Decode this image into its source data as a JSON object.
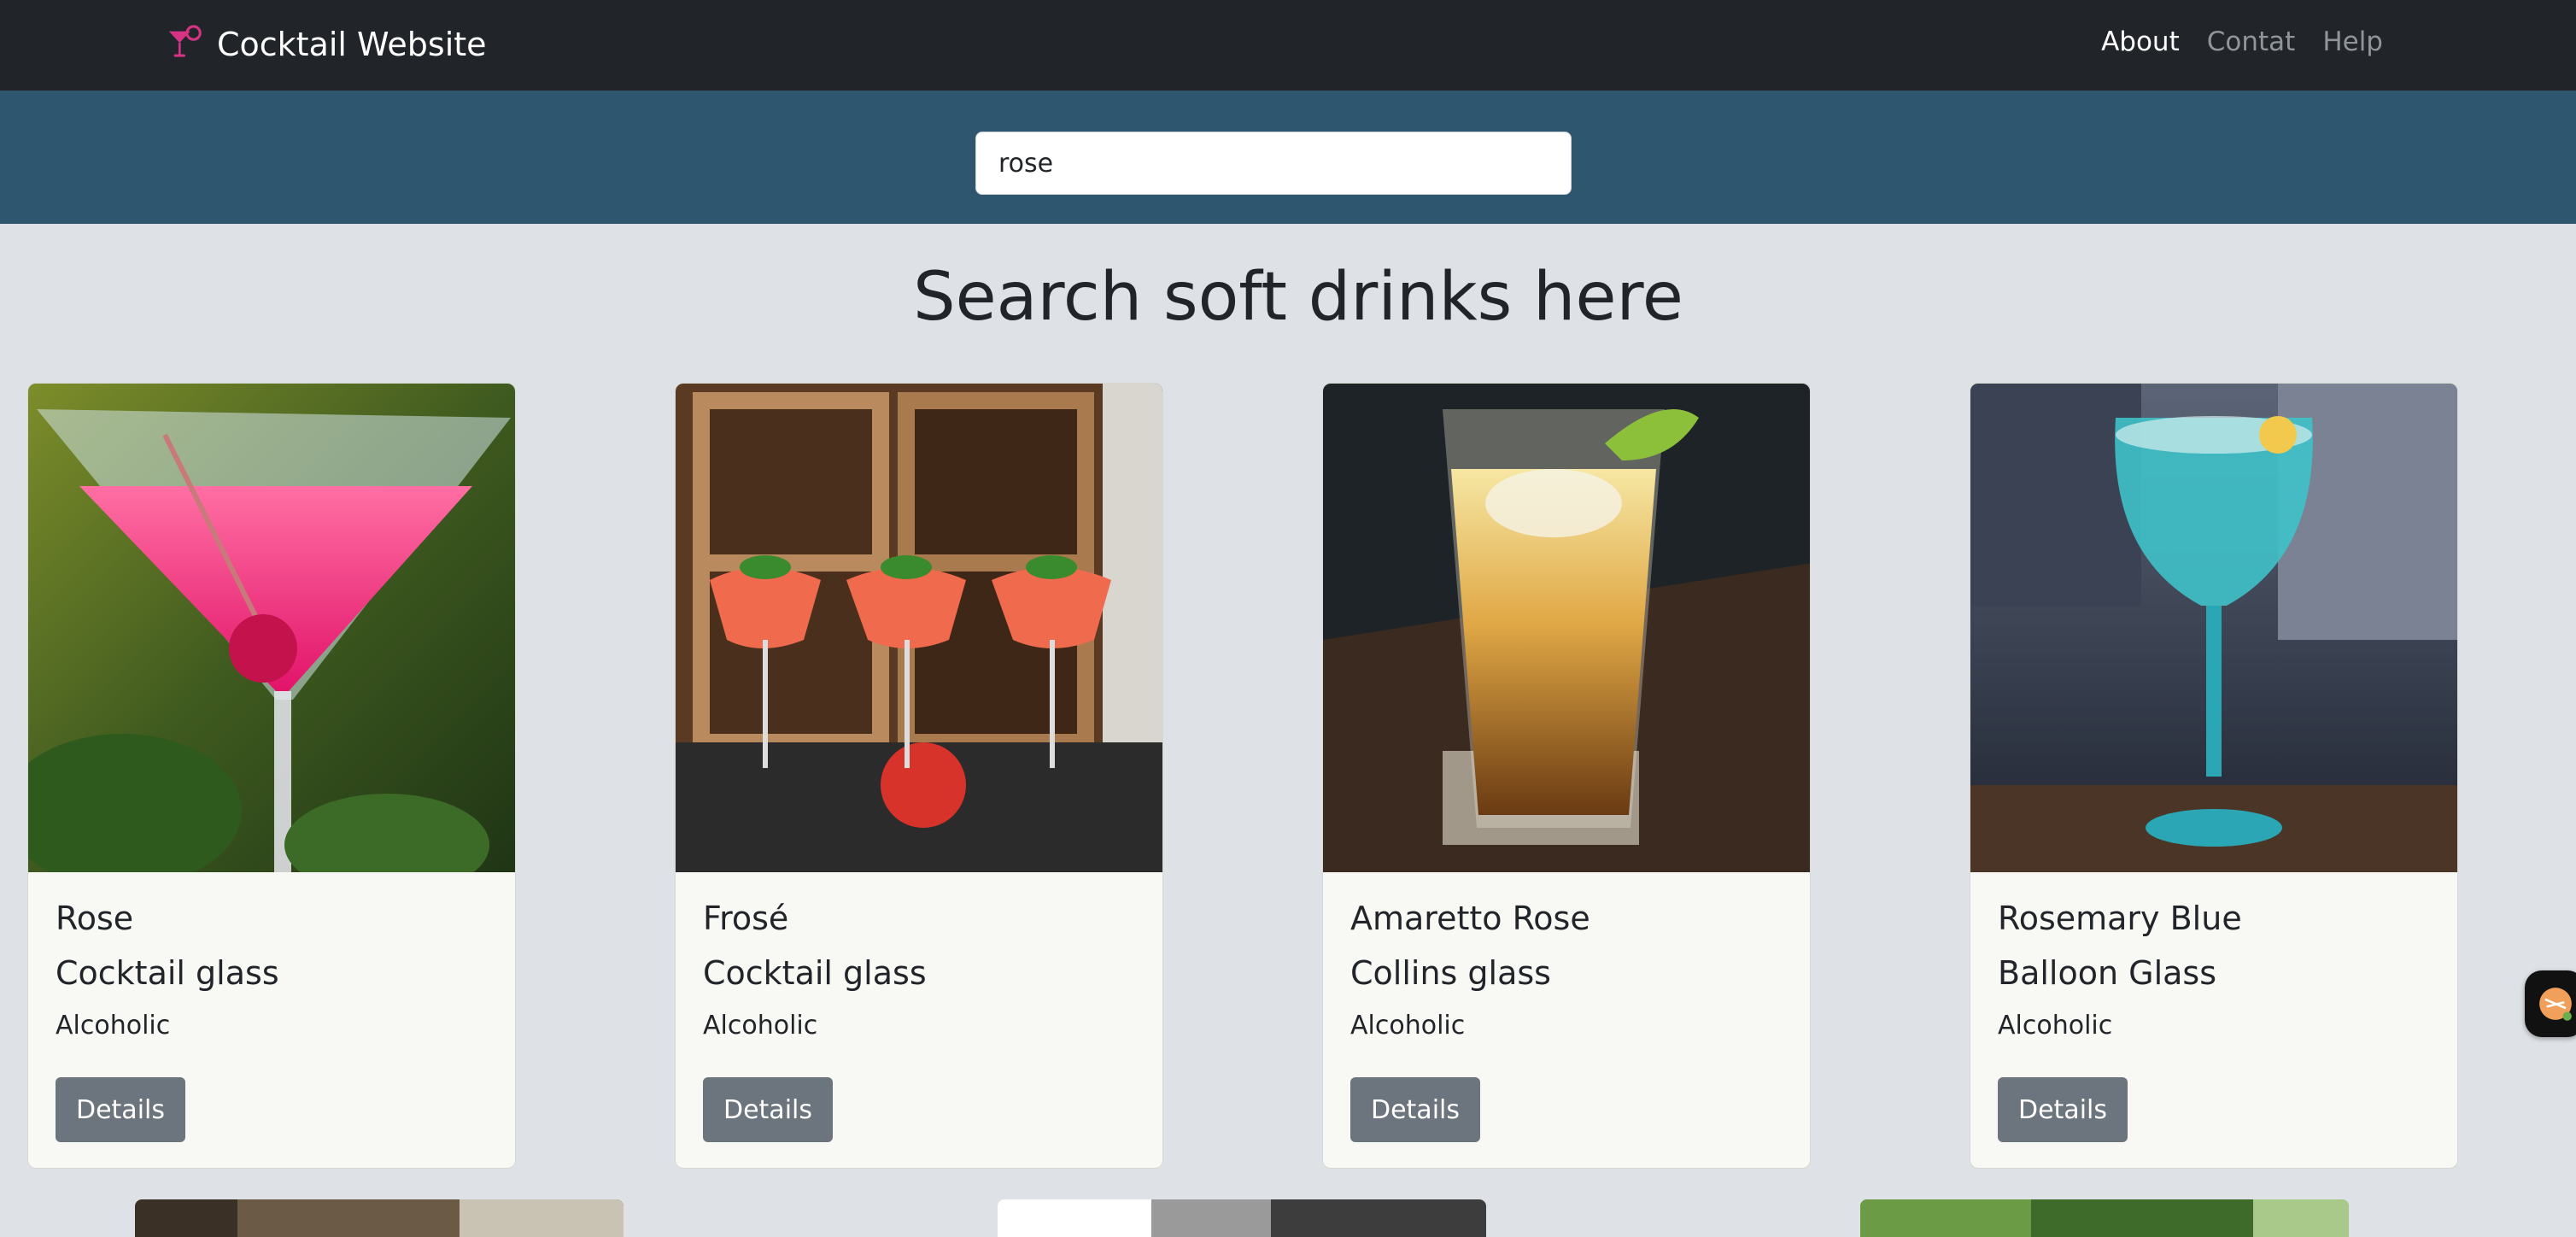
{
  "navbar": {
    "brand": "Cocktail Website",
    "links": [
      {
        "label": "About",
        "active": true
      },
      {
        "label": "Contat",
        "active": false
      },
      {
        "label": "Help",
        "active": false
      }
    ]
  },
  "search": {
    "value": "rose"
  },
  "heading": "Search soft drinks here",
  "cards": [
    {
      "name": "Rose",
      "glass": "Cocktail glass",
      "type": "Alcoholic",
      "button": "Details"
    },
    {
      "name": "Frosé",
      "glass": "Cocktail glass",
      "type": "Alcoholic",
      "button": "Details"
    },
    {
      "name": "Amaretto Rose",
      "glass": "Collins glass",
      "type": "Alcoholic",
      "button": "Details"
    },
    {
      "name": "Rosemary Blue",
      "glass": "Balloon Glass",
      "type": "Alcoholic",
      "button": "Details"
    }
  ],
  "colors": {
    "navbar": "#212529",
    "search_band": "#2f566f",
    "page_bg": "#dee2e6",
    "card_bg": "#f8f8f4",
    "button": "#6c757d",
    "brand_icon": "#d63384"
  },
  "icons": {
    "brand": "cocktail-glass-icon",
    "widget": "floating-widget-icon"
  }
}
